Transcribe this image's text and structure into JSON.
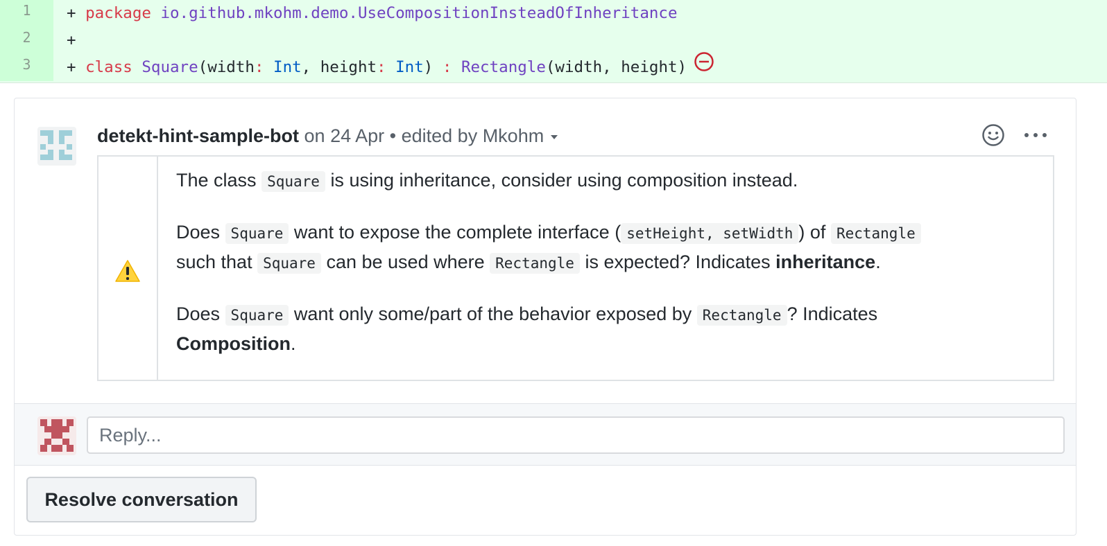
{
  "diff": {
    "lines": [
      {
        "num": "1",
        "plus": "+",
        "keyword": "package",
        "package_name": "io.github.mkohm.demo.UseCompositionInsteadOfInheritance"
      },
      {
        "num": "2",
        "plus": "+"
      },
      {
        "num": "3",
        "plus": "+",
        "keyword": "class",
        "class_name": "Square",
        "p1": "(width",
        "colon1": ":",
        "type1": "Int",
        "comma": ", height",
        "colon2": ":",
        "type2": "Int",
        "close": ")",
        "colon3": " :",
        "parent": "Rectangle",
        "args": "(width, height)"
      }
    ]
  },
  "comment": {
    "author": "detekt-hint-sample-bot",
    "date": "on 24 Apr",
    "separator": "•",
    "edited": "edited by Mkohm",
    "paragraph1": {
      "t1": "The class",
      "c1": "Square",
      "t2": "is using inheritance, consider using composition instead."
    },
    "paragraph2": {
      "t1": "Does",
      "c1": "Square",
      "t2": "want to expose the complete interface (",
      "c2": "setHeight, setWidth",
      "t3": ") of",
      "c3": "Rectangle",
      "t4": "such that",
      "c4": "Square",
      "t5": "can be used where",
      "c5": "Rectangle",
      "t6": "is expected? Indicates",
      "b1": "inheritance",
      "t7": "."
    },
    "paragraph3": {
      "t1": "Does",
      "c1": "Square",
      "t2": "want only some/part of the behavior exposed by",
      "c2": "Rectangle",
      "t3": "? Indicates",
      "b1": "Composition",
      "t4": "."
    }
  },
  "reply": {
    "placeholder": "Reply..."
  },
  "resolve": {
    "label": "Resolve conversation"
  },
  "colors": {
    "diff_bg": "#e6ffed",
    "diff_num_bg": "#cdffd8",
    "keyword": "#d73a49",
    "class": "#6f42c1",
    "type": "#005cc5",
    "blocked": "#cb2431",
    "warn": "#ffd33d"
  },
  "icons": [
    "blocked-icon",
    "bot-avatar",
    "smiley-icon",
    "kebab-icon",
    "warning-icon",
    "user-avatar"
  ]
}
